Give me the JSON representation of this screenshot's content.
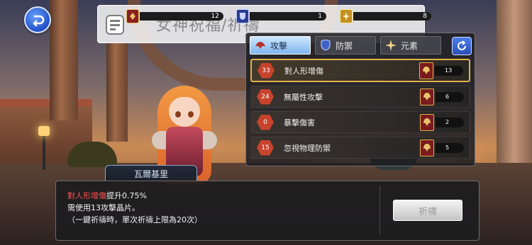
{
  "header": {
    "title": "女神祝福/祈禱",
    "resources": [
      {
        "icon": "attack-crystal-icon",
        "value": "12",
        "color": "#8a1f22"
      },
      {
        "icon": "defense-crystal-icon",
        "value": "1",
        "color": "#2a3d8f"
      },
      {
        "icon": "element-crystal-icon",
        "value": "8",
        "color": "#c49020"
      }
    ]
  },
  "tabs": [
    {
      "label": "攻擊",
      "icon": "wings-emblem-icon",
      "active": true
    },
    {
      "label": "防禦",
      "icon": "shield-icon",
      "active": false
    },
    {
      "label": "元素",
      "icon": "star-icon",
      "active": false
    }
  ],
  "stats": [
    {
      "level": "33",
      "name": "對人形增傷",
      "count": "13",
      "selected": true
    },
    {
      "level": "24",
      "name": "無屬性攻擊",
      "count": "6",
      "selected": false
    },
    {
      "level": "0",
      "name": "暴擊傷害",
      "count": "2",
      "selected": false
    },
    {
      "level": "15",
      "name": "忽視物理防禦",
      "count": "5",
      "selected": false
    }
  ],
  "character": {
    "name": "瓦爾基里"
  },
  "dialog": {
    "stat_name": "對人形增傷",
    "effect": "提升0.75%",
    "line2": "需使用13攻擊晶片。",
    "line3": "（一鍵祈禱時，單次祈禱上限為20次）",
    "button_label": "祈禱"
  }
}
